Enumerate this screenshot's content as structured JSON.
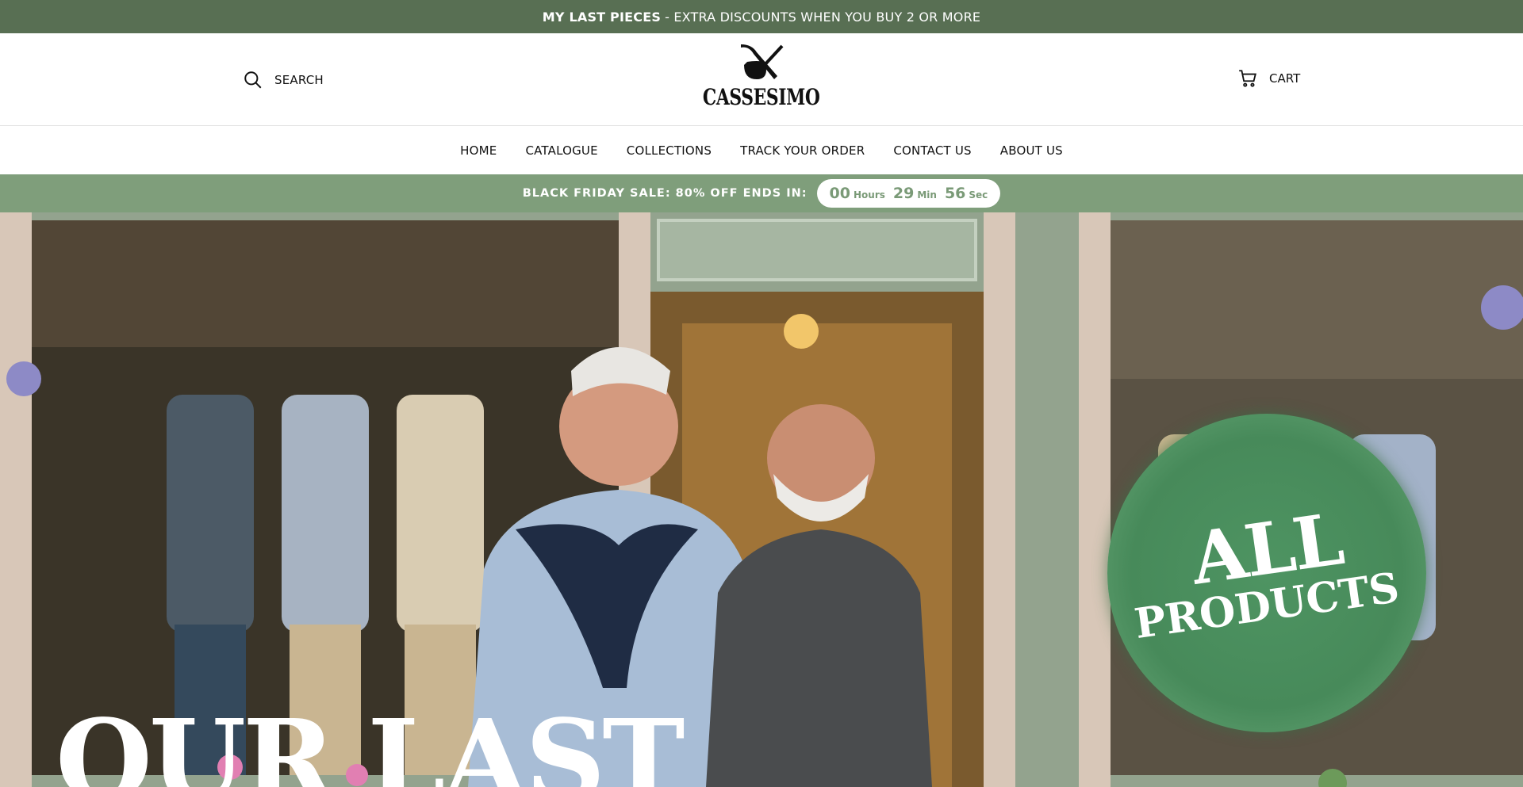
{
  "announcement": {
    "strong": "MY LAST PIECES",
    "rest": "- EXTRA DISCOUNTS WHEN YOU BUY 2 OR MORE"
  },
  "header": {
    "search_label": "SEARCH",
    "search_icon": "search-icon",
    "logo_text": "CASSESIMO",
    "logo_icon": "pipe-icon",
    "cart_label": "CART",
    "cart_icon": "cart-icon"
  },
  "nav": {
    "items": [
      "HOME",
      "CATALOGUE",
      "COLLECTIONS",
      "TRACK YOUR ORDER",
      "CONTACT US",
      "ABOUT US"
    ]
  },
  "sale": {
    "text": "BLACK FRIDAY SALE: 80% OFF ENDS IN:",
    "hours": "00",
    "hours_label": "Hours",
    "minutes": "29",
    "minutes_label": "Min",
    "seconds": "56",
    "seconds_label": "Sec"
  },
  "hero": {
    "badge_line1": "ALL",
    "badge_line2": "PRODUCTS",
    "headline": "OUR LAST"
  },
  "colors": {
    "announcement_bg": "#586f53",
    "sale_bar_bg": "#7f9e7b",
    "badge_green": "#4e9462"
  }
}
